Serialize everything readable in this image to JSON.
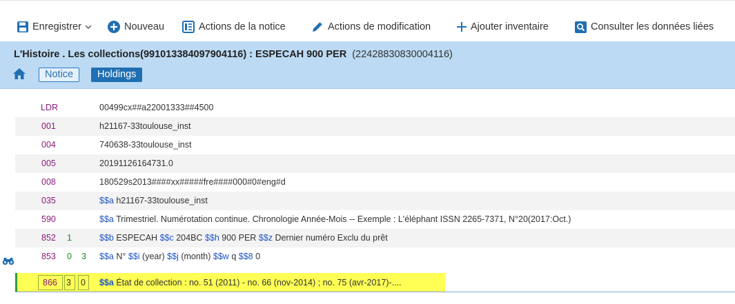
{
  "toolbar": {
    "save": "Enregistrer",
    "new": "Nouveau",
    "record_actions": "Actions de la notice",
    "edit_actions": "Actions de modification",
    "add_inventory": "Ajouter inventaire",
    "linked_data": "Consulter les données liées"
  },
  "header": {
    "title": "L'Histoire . Les collections(991013384097904116) : ESPECAH 900 PER",
    "holding_id": "(22428830830004116)",
    "tab_notice": "Notice",
    "tab_holdings": "Holdings"
  },
  "rows": [
    {
      "tag": "LDR",
      "ind1": "",
      "ind2": "",
      "value": "00499cx##a22001333##4500"
    },
    {
      "tag": "001",
      "ind1": "",
      "ind2": "",
      "value": "h21167-33toulouse_inst"
    },
    {
      "tag": "004",
      "ind1": "",
      "ind2": "",
      "value": "740638-33toulouse_inst"
    },
    {
      "tag": "005",
      "ind1": "",
      "ind2": "",
      "value": "20191126164731.0"
    },
    {
      "tag": "008",
      "ind1": "",
      "ind2": "",
      "value": "180529s2013####xx#####fre####000#0#eng#d"
    },
    {
      "tag": "035",
      "ind1": "",
      "ind2": "",
      "subfields": [
        [
          "$$a",
          "h21167-33toulouse_inst"
        ]
      ]
    },
    {
      "tag": "590",
      "ind1": "",
      "ind2": "",
      "subfields": [
        [
          "$$a",
          "Trimestriel. Numérotation continue. Chronologie Année-Mois -- Exemple : L'éléphant ISSN 2265-7371, N°20(2017:Oct.)"
        ]
      ]
    },
    {
      "tag": "852",
      "ind1": "1",
      "ind2": "",
      "subfields": [
        [
          "$$b",
          "ESPECAH"
        ],
        [
          "$$c",
          "204BC"
        ],
        [
          "$$h",
          "900 PER"
        ],
        [
          "$$z",
          "Dernier numéro Exclu du prêt"
        ]
      ]
    },
    {
      "tag": "853",
      "ind1": "0",
      "ind2": "3",
      "subfields": [
        [
          "$$a",
          "N°"
        ],
        [
          "$$i",
          "(year)"
        ],
        [
          "$$j",
          "(month)"
        ],
        [
          "$$w",
          "q"
        ],
        [
          "$$8",
          "0"
        ]
      ]
    }
  ],
  "field866": {
    "tag": "866",
    "ind1": "3",
    "ind2": "0",
    "code": "$$a",
    "value": "État de collection : no. 51 (2011) - no. 66 (nov-2014) ; no. 75 (avr-2017)-...."
  },
  "colors": {
    "header_bg": "#bcdaf3",
    "accent": "#1f6fb2",
    "highlight": "#ffff55",
    "tag": "#8a1a7a",
    "subfield_code": "#1d56c4",
    "indicator": "#1a8a1a"
  },
  "icons": {
    "save": "floppy-disk-icon",
    "new": "plus-circle-icon",
    "record_actions": "list-icon",
    "edit_actions": "pencil-icon",
    "add_inventory": "plus-icon",
    "linked_data": "search-icon",
    "home": "home-icon",
    "view": "binoculars-icon"
  }
}
